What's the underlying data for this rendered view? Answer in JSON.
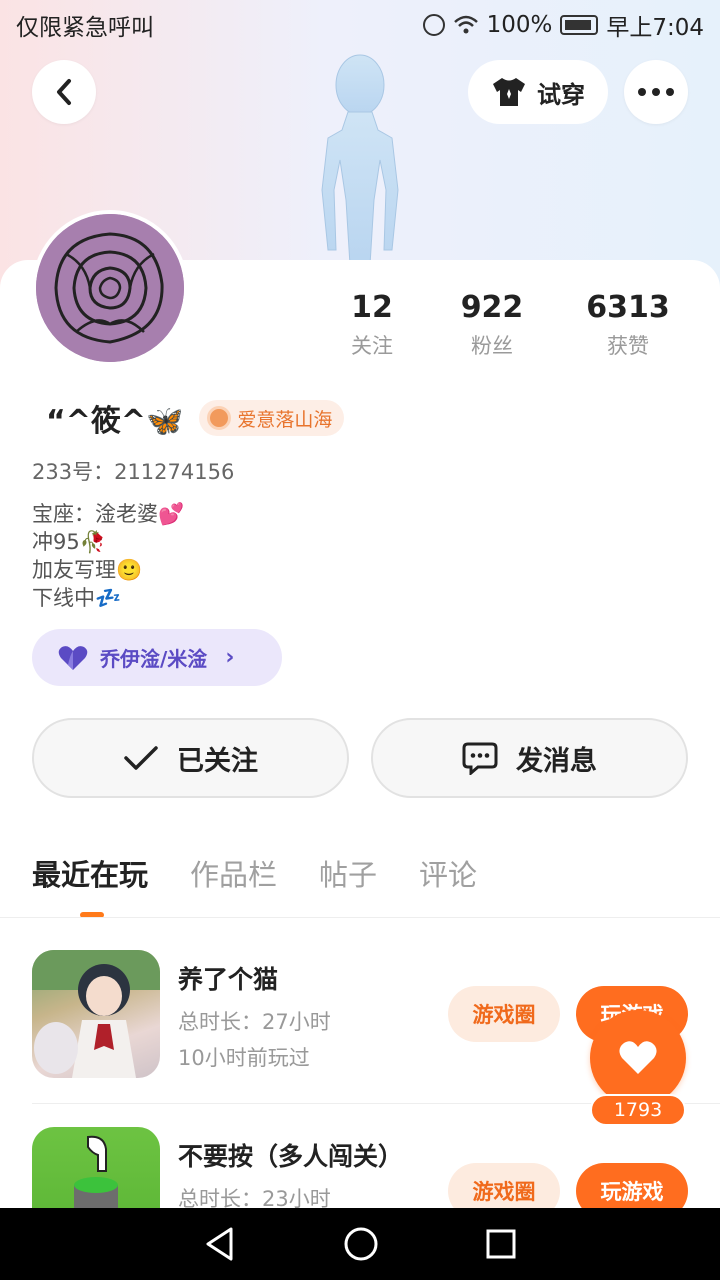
{
  "status_bar": {
    "carrier": "仅限紧急呼叫",
    "battery": "100%",
    "time": "早上7:04"
  },
  "header": {
    "try_on_label": "试穿"
  },
  "profile": {
    "stats": [
      {
        "value": "12",
        "label": "关注"
      },
      {
        "value": "922",
        "label": "粉丝"
      },
      {
        "value": "6313",
        "label": "获赞"
      }
    ],
    "name": "“^筱^🦋",
    "badge": "爱意落山海",
    "uid": "233号：211274156",
    "bio": [
      "宝座：淦老婆💕",
      "冲95🥀",
      "加友写理🙂",
      "下线中💤"
    ],
    "cp_tag": "乔伊淦/米淦"
  },
  "actions": {
    "follow_label": "已关注",
    "message_label": "发消息"
  },
  "tabs": [
    "最近在玩",
    "作品栏",
    "帖子",
    "评论"
  ],
  "games": [
    {
      "title": "养了个猫",
      "total_time": "总时长：27小时",
      "last_played": "10小时前玩过",
      "circle_btn": "游戏圈",
      "play_btn": "玩游戏"
    },
    {
      "title": "不要按（多人闯关）",
      "total_time": "总时长：23小时",
      "circle_btn": "游戏圈",
      "play_btn": "玩游戏"
    }
  ],
  "float_like": {
    "count": "1793"
  },
  "colors": {
    "accent": "#ff6d1f",
    "cp_purple": "#5b4bc4"
  }
}
